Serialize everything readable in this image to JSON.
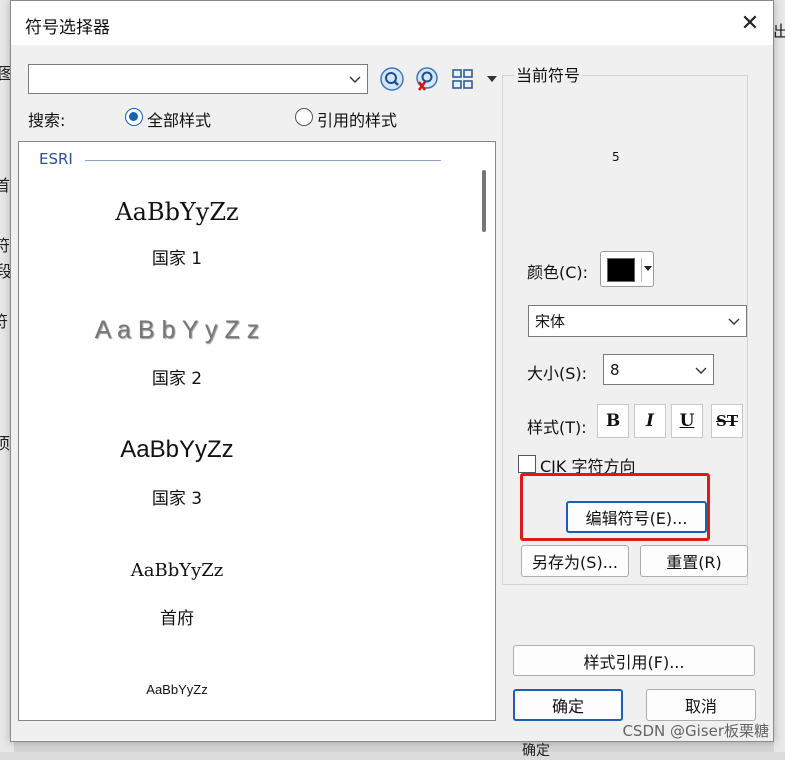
{
  "background": {
    "left_chars": [
      "图",
      "首",
      "符",
      "段",
      "符",
      "项"
    ],
    "right_chars": [
      "出"
    ],
    "bottom_label": "确定"
  },
  "dialog": {
    "title": "符号选择器",
    "close_label": "✕"
  },
  "search": {
    "value": "",
    "label": "搜索:",
    "radio_all": "全部样式",
    "radio_ref": "引用的样式",
    "selected": "all"
  },
  "toolbar": {
    "icons": [
      "search-icon",
      "clear-search-icon",
      "view-grid-icon"
    ]
  },
  "list": {
    "group": "ESRI",
    "items": [
      {
        "sample": "AaBbYyZz",
        "label": "国家 1"
      },
      {
        "sample": "A a B b Y y Z z",
        "label": "国家 2"
      },
      {
        "sample": "AaBbYyZz",
        "label": "国家 3"
      },
      {
        "sample": "AaBbYyZz",
        "label": "首府"
      },
      {
        "sample": "AaBbYyZz",
        "label": ""
      }
    ]
  },
  "current_symbol": {
    "title": "当前符号",
    "preview_text": "5",
    "color_label": "颜色(C):",
    "color_value": "#000000",
    "font_value": "宋体",
    "size_label": "大小(S):",
    "size_value": "8",
    "style_label": "样式(T):",
    "style_buttons": [
      "B",
      "I",
      "U",
      "ST"
    ],
    "cjk_label": "CJK 字符方向",
    "cjk_checked": false,
    "edit_button": "编辑符号(E)...",
    "save_as_button": "另存为(S)...",
    "reset_button": "重置(R)"
  },
  "footer": {
    "style_refs_button": "样式引用(F)...",
    "ok_button": "确定",
    "cancel_button": "取消"
  },
  "watermark": "CSDN @Giser板栗糖",
  "colors": {
    "accent": "#1a5fb4",
    "highlight_box": "#e01818",
    "group_header": "#2a4f9a"
  }
}
